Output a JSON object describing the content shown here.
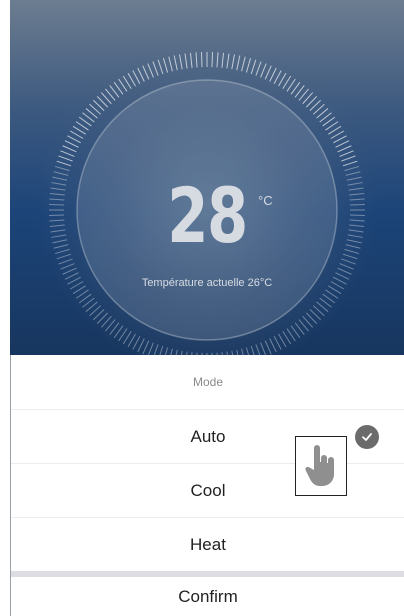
{
  "thermostat": {
    "temperature": "28",
    "unit": "°C",
    "current_label": "Température actuelle 26°C"
  },
  "mode_sheet": {
    "title": "Mode",
    "options": [
      {
        "label": "Auto",
        "selected": true
      },
      {
        "label": "Cool",
        "selected": false
      },
      {
        "label": "Heat",
        "selected": false
      }
    ],
    "confirm_label": "Confirm"
  },
  "icons": {
    "selected": "check-circle-icon",
    "pointer": "hand-pointer-icon"
  },
  "colors": {
    "background_top": "#6d7d90",
    "background_bottom": "#17365f",
    "check": "#6b6b6b",
    "divider": "#dedde3"
  }
}
